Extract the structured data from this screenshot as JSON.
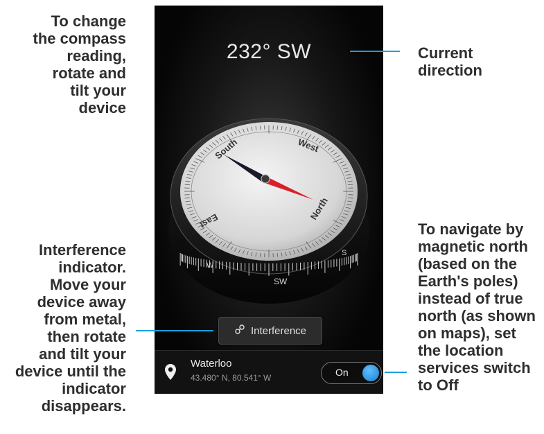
{
  "callouts": {
    "change": "To change\nthe compass\nreading,\nrotate and\ntilt your\ndevice",
    "current": "Current\ndirection",
    "interference": "Interference\nindicator.\nMove your\ndevice away\nfrom metal,\nthen rotate\nand tilt your\ndevice until the\nindicator\ndisappears.",
    "navigate": "To navigate by\nmagnetic north\n(based on the\nEarth's poles)\ninstead of true\nnorth (as shown\non maps), set\nthe location\nservices switch\nto Off"
  },
  "compass": {
    "reading": "232° SW",
    "dial_labels": {
      "south": "South",
      "west": "West",
      "north": "North",
      "east": "East",
      "sw": "SW",
      "w": "W",
      "s": "S"
    },
    "needle_north_color": "#d8202a",
    "needle_south_color": "#1a1a2a"
  },
  "interference_button": {
    "label": "Interference",
    "icon": "link-icon"
  },
  "location": {
    "name": "Waterloo",
    "coords": "43.480° N, 80.541° W",
    "icon": "location-pin-icon"
  },
  "location_switch": {
    "label": "On",
    "state": "on",
    "accent": "#1a9fe0"
  },
  "colors": {
    "callout_line": "#1a9fe0",
    "callout_text": "#2e2e2e"
  }
}
